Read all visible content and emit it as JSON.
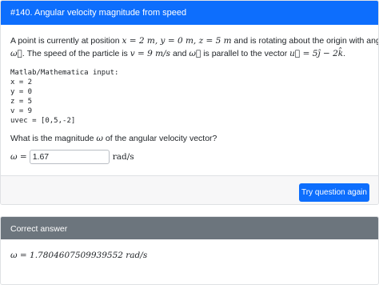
{
  "question": {
    "title": "#140. Angular velocity magnitude from speed",
    "line1_text": "A point is currently at position",
    "line1_math": "x = 2 m, y = 0 m, z = 5 m",
    "line1_rest": "and is rotating about the origin with angular velocity",
    "line2_omega": "ω⃗",
    "line2_text_a": ". The speed of the particle is",
    "line2_math_v": "v = 9 m/s",
    "line2_text_b": "and",
    "line2_omega2": "ω⃗",
    "line2_text_c": "is parallel to the vector",
    "line2_math_u": "u⃗ = 5ĵ − 2k̂",
    "line2_end": ".",
    "code": "Matlab/Mathematica input:\nx = 2\ny = 0\nz = 5\nv = 9\nuvec = [0,5,-2]",
    "prompt_a": "What is the magnitude",
    "prompt_symbol": "ω",
    "prompt_b": "of the angular velocity vector?",
    "answer_label": "ω =",
    "answer_value": "1.67",
    "answer_unit": "rad/s",
    "button_label": "Try question again"
  },
  "correct": {
    "header": "Correct answer",
    "answer_text": "ω = 1.7804607509939552 rad/s"
  }
}
